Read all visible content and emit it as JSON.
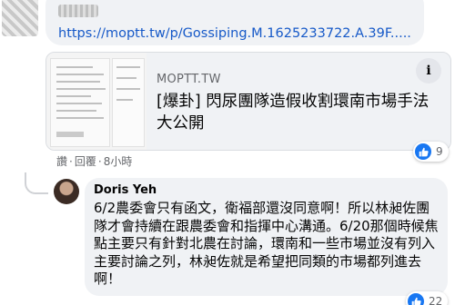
{
  "previous_comment": {
    "link_text": "https://moptt.tw/p/Gossiping.M.1625233722.A.39F.....",
    "like_count": "9"
  },
  "link_preview": {
    "domain": "MOPTT.TW",
    "title": "[爆卦] 閃尿團隊造假收割環南市場手法大公開",
    "info_icon": "info-icon"
  },
  "actions": {
    "like_label": "讚",
    "reply_label": "回覆",
    "time_label": "8小時"
  },
  "reply": {
    "author": "Doris Yeh",
    "text": "6/2農委會只有函文，衛福部還沒同意啊！所以林昶佐團隊才會持續在跟農委會和指揮中心溝通。6/20那個時候焦點主要只有針對北農在討論，環南和一些市場並沒有列入主要討論之列，林昶佐就是希望把同類的市場都列進去啊！",
    "like_count": "22"
  },
  "colors": {
    "link": "#1659c8",
    "like_blue": "#1877f2",
    "bubble_bg": "#f0f2f5",
    "meta_gray": "#65676b"
  }
}
